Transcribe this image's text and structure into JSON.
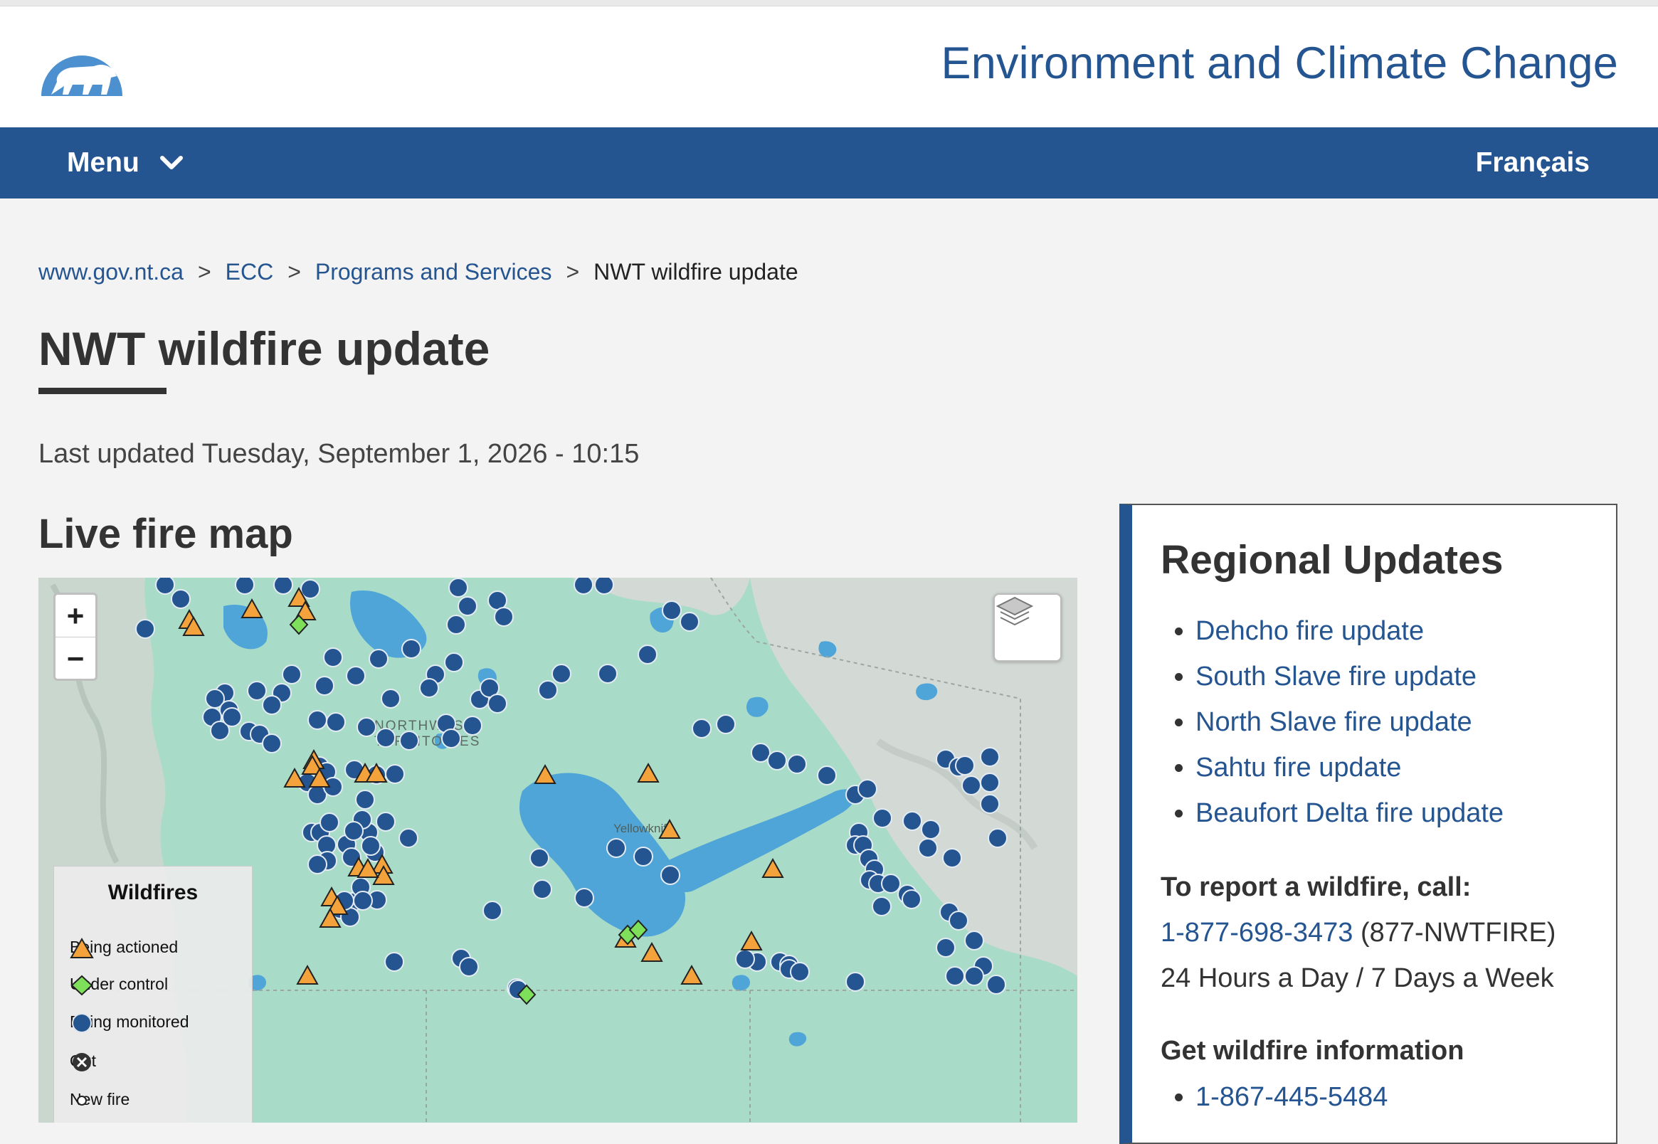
{
  "header": {
    "department": "Environment and Climate Change",
    "logo_icon": "polar-bear-sun-icon",
    "brand_color": "#255591"
  },
  "nav": {
    "menu_label": "Menu",
    "menu_icon": "chevron-down-icon",
    "language_label": "Français"
  },
  "breadcrumb": {
    "items": [
      "www.gov.nt.ca",
      "ECC",
      "Programs and Services",
      "NWT wildfire update"
    ],
    "separator": ">"
  },
  "page": {
    "title": "NWT wildfire update",
    "last_updated": "Last updated Tuesday, September 1, 2026 - 10:15"
  },
  "map_section": {
    "title": "Live fire map",
    "zoom_in": "+",
    "zoom_out": "−",
    "layers_icon": "layers-icon",
    "place_labels": [
      "NORTHWEST",
      "TERRITORIES",
      "Yellowknife"
    ],
    "legend": {
      "title": "Wildfires",
      "items": [
        "Being actioned",
        "Under control",
        "Being monitored",
        "Out",
        "New fire"
      ]
    },
    "status_colors": {
      "being_actioned": "#f3a23c",
      "under_control": "#7ee05a",
      "being_monitored": "#255591"
    }
  },
  "regional": {
    "title": "Regional Updates",
    "links": [
      "Dehcho fire update",
      "South Slave fire update",
      "North Slave fire update",
      "Sahtu fire update",
      "Beaufort Delta fire update"
    ],
    "report_heading": "To report a wildfire, call:",
    "report_phone": "1-877-698-3473",
    "report_phone_alias": "(877-NWTFIRE)",
    "hours": "24 Hours a Day / 7 Days a Week",
    "info_heading": "Get wildfire information",
    "info_phone": "1-867-445-5484"
  }
}
